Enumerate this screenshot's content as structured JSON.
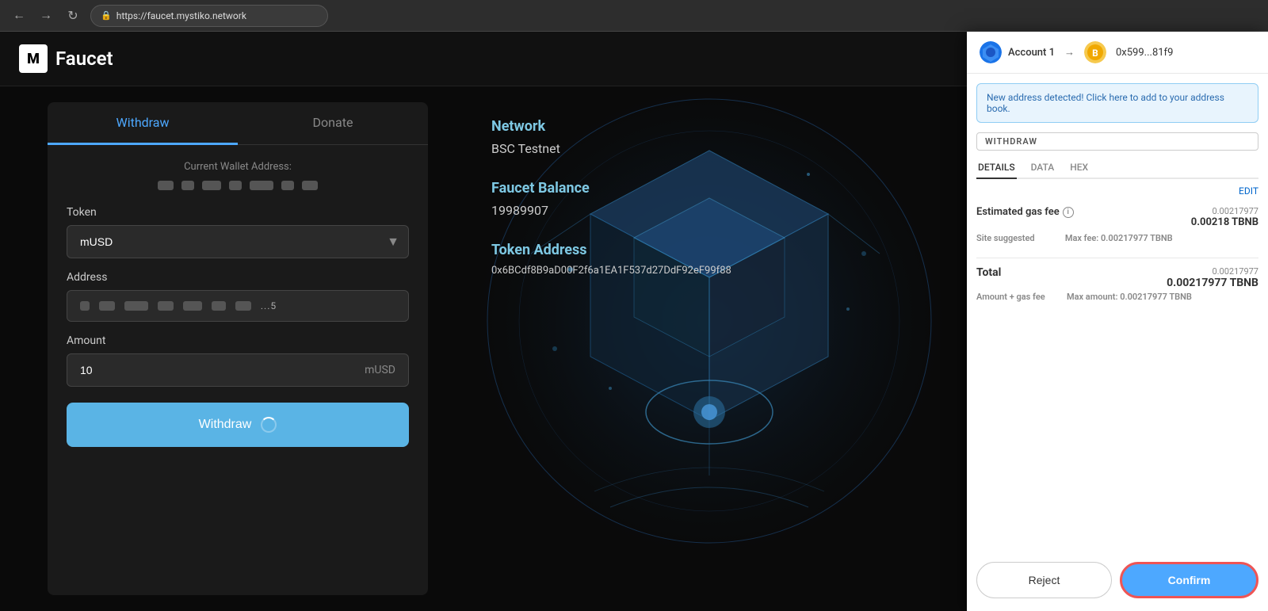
{
  "browser": {
    "url": "https://faucet.mystiko.network",
    "back_label": "←",
    "forward_label": "→",
    "refresh_label": "↻"
  },
  "app": {
    "logo_text": "Faucet",
    "logo_letter": "M"
  },
  "tabs": {
    "withdraw_label": "Withdraw",
    "donate_label": "Donate"
  },
  "form": {
    "wallet_address_label": "Current Wallet Address:",
    "token_label": "Token",
    "token_value": "mUSD",
    "address_label": "Address",
    "amount_label": "Amount",
    "amount_value": "10",
    "amount_unit": "mUSD",
    "withdraw_btn_label": "Withdraw"
  },
  "info": {
    "network_title": "Network",
    "network_value": "BSC Testnet",
    "balance_title": "Faucet Balance",
    "balance_value": "19989907",
    "token_address_title": "Token Address",
    "token_address_value": "0x6BCdf8B9aD00F2f6a1EA1F537d27DdF92eF99f88"
  },
  "metamask": {
    "account_name": "Account 1",
    "address_short": "0x599...81f9",
    "alert_text": "New address detected! Click here to add to your address book.",
    "withdraw_badge": "WITHDRAW",
    "tab_details": "DETAILS",
    "tab_data": "DATA",
    "tab_hex": "HEX",
    "edit_label": "EDIT",
    "gas_fee_label": "Estimated gas fee",
    "gas_fee_small": "0.00217977",
    "gas_fee_main": "0.00218 TBNB",
    "site_suggested_label": "Site suggested",
    "max_fee_label": "Max fee: 0.00217977 TBNB",
    "total_label": "Total",
    "total_small": "0.00217977",
    "total_main": "0.00217977 TBNB",
    "amount_gas_label": "Amount + gas fee",
    "max_amount_label": "Max amount: 0.00217977 TBNB",
    "reject_btn": "Reject",
    "confirm_btn": "Confirm"
  }
}
